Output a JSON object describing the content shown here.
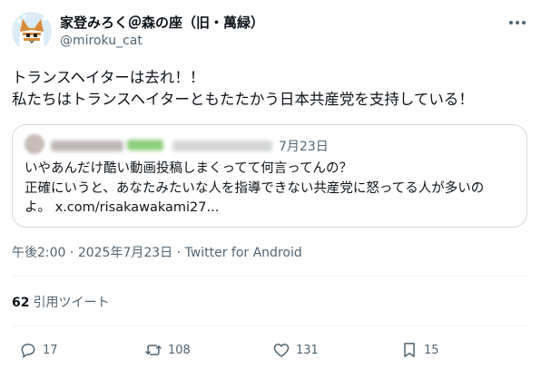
{
  "author": {
    "display_name": "家登みろく＠森の座（旧・萬緑）",
    "handle": "@miroku_cat"
  },
  "tweet": {
    "lines": [
      "トランスヘイターは去れ！！",
      "私たちはトランスヘイターともたたかう日本共産党を支持している！"
    ]
  },
  "quoted_tweet": {
    "date": "7月23日",
    "lines": [
      "いやあんだけ酷い動画投稿しまくってて何言ってんの？",
      "正確にいうと、あなたみたいな人を指導できない共産党に怒ってる人が多いの",
      "よ。 x.com/risakawakami27..."
    ]
  },
  "meta": {
    "time": "午後2:00",
    "separator": " · ",
    "date": "2025年7月23日",
    "client": "Twitter for Android"
  },
  "stats": {
    "quote_count": "62",
    "quote_label": "引用ツイート"
  },
  "actions": {
    "replies": "17",
    "retweets": "108",
    "likes": "131",
    "bookmarks": "15"
  },
  "colors": {
    "text": "#0f1419",
    "secondary": "#536471",
    "border": "#cfd9de",
    "avatar_bg": "#d9ecf8"
  },
  "icons": [
    "more-icon",
    "reply-icon",
    "retweet-icon",
    "like-icon",
    "bookmark-icon"
  ]
}
